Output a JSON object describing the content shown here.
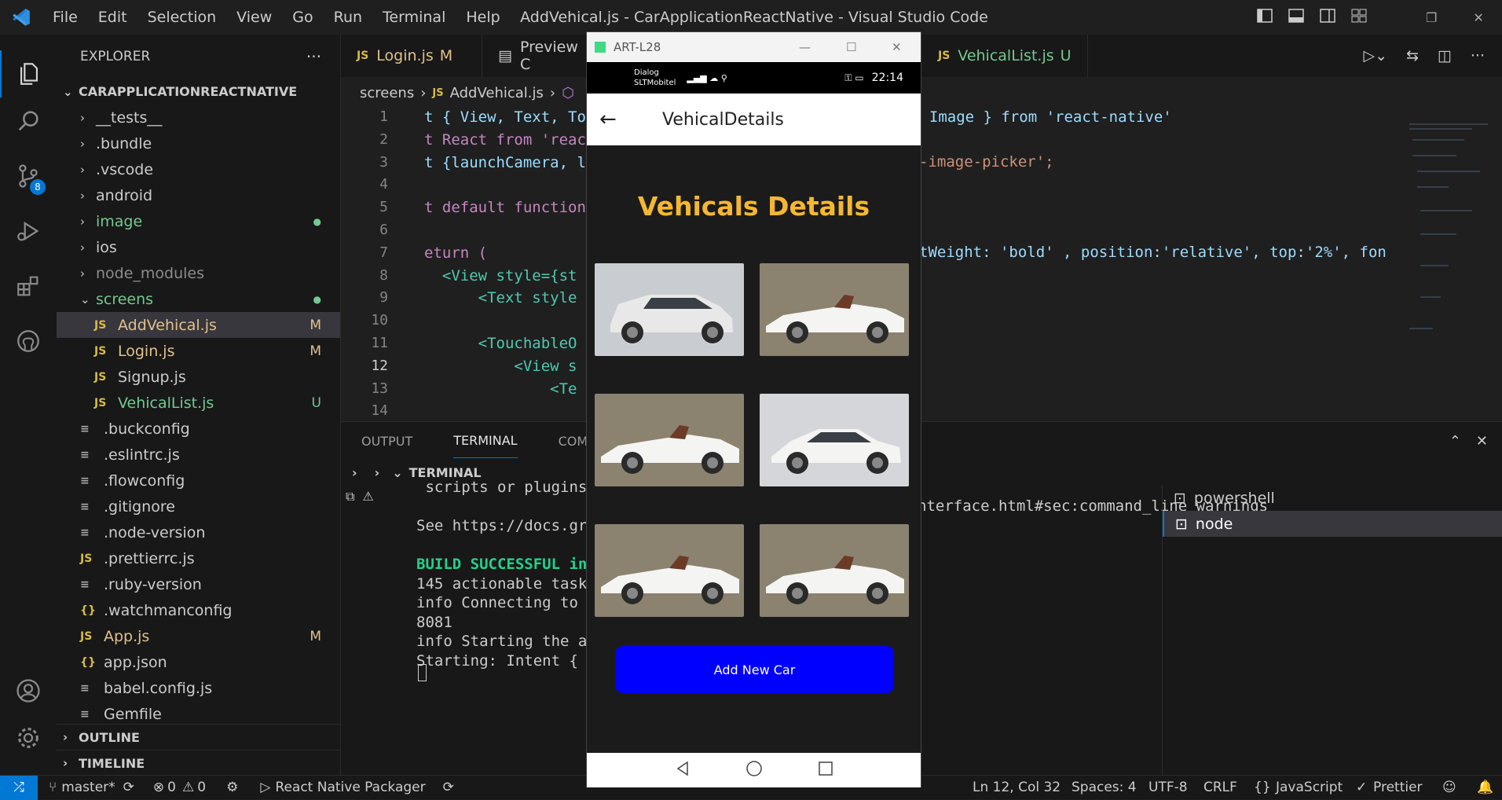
{
  "window": {
    "title": "AddVehical.js - CarApplicationReactNative - Visual Studio Code",
    "menu": [
      "File",
      "Edit",
      "Selection",
      "View",
      "Go",
      "Run",
      "Terminal",
      "Help"
    ]
  },
  "activity": {
    "source_control_badge": "8"
  },
  "explorer": {
    "title": "EXPLORER",
    "more": "···",
    "project": "CARAPPLICATIONREACTNATIVE",
    "items": [
      {
        "label": "__tests__",
        "type": "folder",
        "badge": ""
      },
      {
        "label": ".bundle",
        "type": "folder",
        "badge": ""
      },
      {
        "label": ".vscode",
        "type": "folder",
        "badge": ""
      },
      {
        "label": "android",
        "type": "folder",
        "badge": ""
      },
      {
        "label": "image",
        "type": "folder",
        "badge": "●"
      },
      {
        "label": "ios",
        "type": "folder",
        "badge": ""
      },
      {
        "label": "node_modules",
        "type": "folder",
        "badge": ""
      },
      {
        "label": "screens",
        "type": "folder-open",
        "badge": "●"
      },
      {
        "label": "AddVehical.js",
        "type": "js",
        "badge": "M"
      },
      {
        "label": "Login.js",
        "type": "js",
        "badge": "M"
      },
      {
        "label": "Signup.js",
        "type": "js",
        "badge": ""
      },
      {
        "label": "VehicalList.js",
        "type": "js",
        "badge": "U"
      },
      {
        "label": ".buckconfig",
        "type": "file",
        "badge": ""
      },
      {
        "label": ".eslintrc.js",
        "type": "file",
        "badge": ""
      },
      {
        "label": ".flowconfig",
        "type": "file",
        "badge": ""
      },
      {
        "label": ".gitignore",
        "type": "file",
        "badge": ""
      },
      {
        "label": ".node-version",
        "type": "file",
        "badge": ""
      },
      {
        "label": ".prettierrc.js",
        "type": "js",
        "badge": ""
      },
      {
        "label": ".ruby-version",
        "type": "file",
        "badge": ""
      },
      {
        "label": ".watchmanconfig",
        "type": "json",
        "badge": ""
      },
      {
        "label": "App.js",
        "type": "js",
        "badge": "M"
      },
      {
        "label": "app.json",
        "type": "json",
        "badge": ""
      },
      {
        "label": "babel.config.js",
        "type": "file",
        "badge": ""
      },
      {
        "label": "Gemfile",
        "type": "file",
        "badge": ""
      }
    ],
    "outline": "OUTLINE",
    "timeline": "TIMELINE"
  },
  "editor": {
    "tabs": [
      {
        "label": "Login.js",
        "badge": "M"
      },
      {
        "label": "Preview C",
        "badge": ""
      },
      {
        "label": "VehicalList.js",
        "badge": "U"
      }
    ],
    "breadcrumb": [
      "screens",
      "AddVehical.js"
    ],
    "lines": [
      {
        "n": "1",
        "text": "t { View, Text, To"
      },
      {
        "n": "2",
        "text": "t React from 'reac"
      },
      {
        "n": "3",
        "text": "t {launchCamera, l"
      },
      {
        "n": "4",
        "text": ""
      },
      {
        "n": "5",
        "text": "t default function"
      },
      {
        "n": "6",
        "text": ""
      },
      {
        "n": "7",
        "text": "eturn ("
      },
      {
        "n": "8",
        "text": "  <View style={st"
      },
      {
        "n": "9",
        "text": "      <Text style"
      },
      {
        "n": "10",
        "text": ""
      },
      {
        "n": "11",
        "text": "      <TouchableO"
      },
      {
        "n": "12",
        "text": "          <View s"
      },
      {
        "n": "13",
        "text": "              <Te"
      },
      {
        "n": "14",
        "text": ""
      }
    ],
    "right_lines": [
      {
        "n": "1",
        "text": ", Image } from 'react-native'"
      },
      {
        "n": "3",
        "text": "-image-picker';"
      },
      {
        "n": "9",
        "text": "tWeight: 'bold' , position:'relative', top:'2%', fon"
      }
    ]
  },
  "panel": {
    "tabs": [
      "OUTPUT",
      "TERMINAL",
      "COMMEN"
    ],
    "terminal_header": "TERMINAL",
    "left_lines": [
      " scripts or plugins.",
      "",
      "See https://docs.gra",
      "",
      "BUILD SUCCESSFUL in",
      "145 actionable tasks",
      "info Connecting to t",
      "8081",
      "info Starting the ap",
      "Starting: Intent { c"
    ],
    "right_line": "nterface.html#sec:command_line_warnings",
    "shells": [
      "powershell",
      "node"
    ]
  },
  "status": {
    "branch": "master*",
    "errors": "0",
    "warnings": "0",
    "packager": "React Native Packager",
    "position": "Ln 12, Col 32",
    "spaces": "Spaces: 4",
    "encoding": "UTF-8",
    "eol": "CRLF",
    "language": "JavaScript",
    "prettier": "Prettier"
  },
  "emulator": {
    "title": "ART-L28",
    "carrier1": "Dialog",
    "carrier2": "SLTMobitel",
    "time": "22:14",
    "screen_title": "VehicalDetails",
    "heading": "Vehicals Details",
    "button": "Add New Car",
    "colors": {
      "heading": "#f5b731",
      "button": "#0000ff"
    }
  }
}
